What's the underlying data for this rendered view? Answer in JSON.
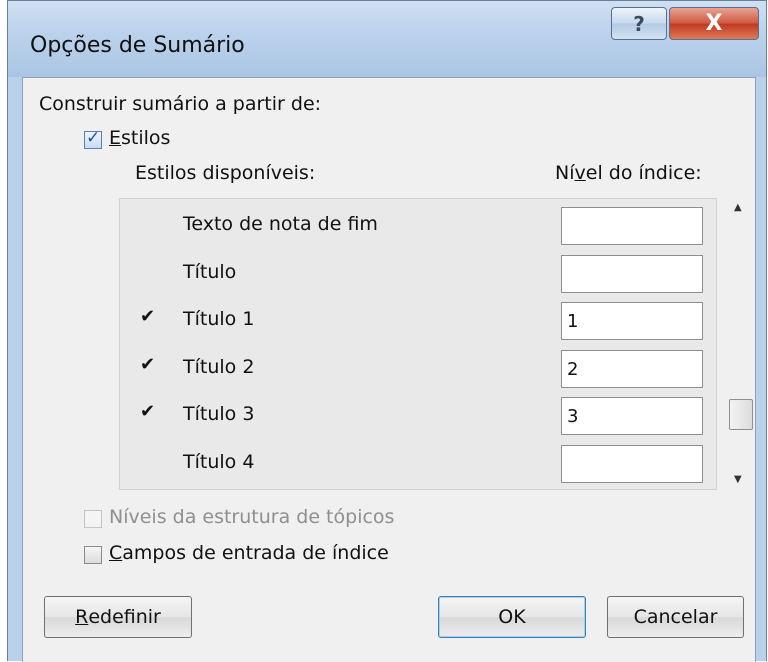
{
  "dialog": {
    "title": "Opções de Sumário",
    "help_label": "?",
    "close_label": "X"
  },
  "construct_label": "Construir sumário a partir de:",
  "styles_checkbox": {
    "label_first": "E",
    "label_rest": "stilos",
    "checked": true
  },
  "available_styles_label": "Estilos disponíveis:",
  "index_level_label": {
    "before": "Ní",
    "underlined": "v",
    "after": "el do índice:"
  },
  "styles_list": [
    {
      "checked": false,
      "name": "Texto de nota de fim",
      "level": ""
    },
    {
      "checked": false,
      "name": "Título",
      "level": ""
    },
    {
      "checked": true,
      "name": "Título 1",
      "level": "1"
    },
    {
      "checked": true,
      "name": "Título 2",
      "level": "2"
    },
    {
      "checked": true,
      "name": "Título 3",
      "level": "3"
    },
    {
      "checked": false,
      "name": "Título 4",
      "level": ""
    }
  ],
  "check_mark": "✔",
  "outline_levels_checkbox": {
    "label": "Níveis da estrutura de tópicos",
    "checked": false,
    "enabled": false
  },
  "index_fields_checkbox": {
    "label_first": "C",
    "label_rest": "ampos de entrada de índice",
    "checked": false
  },
  "buttons": {
    "reset": {
      "first": "R",
      "rest": "edefinir"
    },
    "ok": "OK",
    "cancel": "Cancelar"
  },
  "scroll": {
    "up": "▲",
    "down": "▼"
  }
}
